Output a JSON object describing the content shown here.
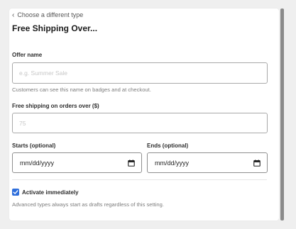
{
  "form": {
    "back_link": "Choose a different type",
    "title": "Free Shipping Over...",
    "offer_name": {
      "label": "Offer name",
      "value": "",
      "placeholder": "e.g. Summer Sale",
      "hint": "Customers can see this name on badges and at checkout."
    },
    "threshold": {
      "label": "Free shipping on orders over ($)",
      "value": "",
      "placeholder": "75"
    },
    "starts": {
      "label": "Starts (optional)",
      "value": "mm/dd/yyyy"
    },
    "ends": {
      "label": "Ends (optional)",
      "value": "mm/dd/yyyy"
    },
    "activate": {
      "label": "Activate immediately",
      "checked": true,
      "hint": "Advanced types always start as drafts regardless of this setting."
    }
  },
  "colors": {
    "accent": "#2f6fdc",
    "background": "#efefef",
    "panel": "#ffffff"
  },
  "icons": {
    "back": "chevron-left-icon",
    "date": "calendar-icon",
    "checkbox": "checkmark-icon"
  }
}
